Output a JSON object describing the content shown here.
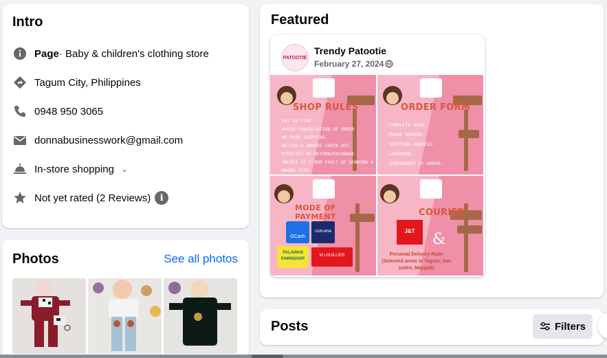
{
  "intro": {
    "title": "Intro",
    "page_label": "Page",
    "page_category": " · Baby & children's clothing store",
    "location": "Tagum City, Philippines",
    "phone": "0948 950 3065",
    "email": "donnabusinesswork@gmail.com",
    "service": "In-store shopping",
    "rating": "Not yet rated (2 Reviews)",
    "icons": [
      "info-icon",
      "directions-icon",
      "phone-icon",
      "mail-icon",
      "bell-icon",
      "star-icon"
    ]
  },
  "photos": {
    "title": "Photos",
    "see_all": "See all photos",
    "thumbs": [
      "photo-1",
      "photo-2",
      "photo-3"
    ]
  },
  "featured": {
    "title": "Featured",
    "post": {
      "author": "Trendy Patootie",
      "date": "February 27, 2024",
      "avatar_text": "PATOOTIE",
      "tiles": [
        {
          "title": "SHOP RULES",
          "lines": [
            "PAY ON TIME",
            "AVOID CANCELLATION OF ORDER",
            "NO RUSH SHIPPING",
            "NO COD & SHOPEE CHECK-OUT",
            "STRICTLY NO RETURN/EXCHANGE",
            "UNLESS IT'S OUR FAULT OF SENDING A",
            "WRONG ITEM"
          ]
        },
        {
          "title": "ORDER FORM",
          "lines": [
            "COMPLETE NAME:",
            "PHONE NUMBER:",
            "SHIPPING ADDRESS:",
            "LANDMARK:",
            "SCREENSHOT OF ORDER:"
          ]
        },
        {
          "title": "MODE OF PAYMENT",
          "payments": [
            "GCash",
            "CEBUANA",
            "PALAWAN PAWNSHOP",
            "M LHUILLIER"
          ]
        },
        {
          "title": "COURIER",
          "couriers": [
            "J&T",
            "&"
          ],
          "note": "Personal Delivery Rider (Selected areas in Tagum, San Isidro, Maygob)"
        }
      ]
    }
  },
  "posts": {
    "title": "Posts",
    "filters_label": "Filters"
  },
  "colors": {
    "accent": "#0866ff",
    "card_bg": "#ffffff",
    "page_bg": "#f0f2f5",
    "tile_pink": "#f7b6c6",
    "title_orange": "#d9583a"
  }
}
